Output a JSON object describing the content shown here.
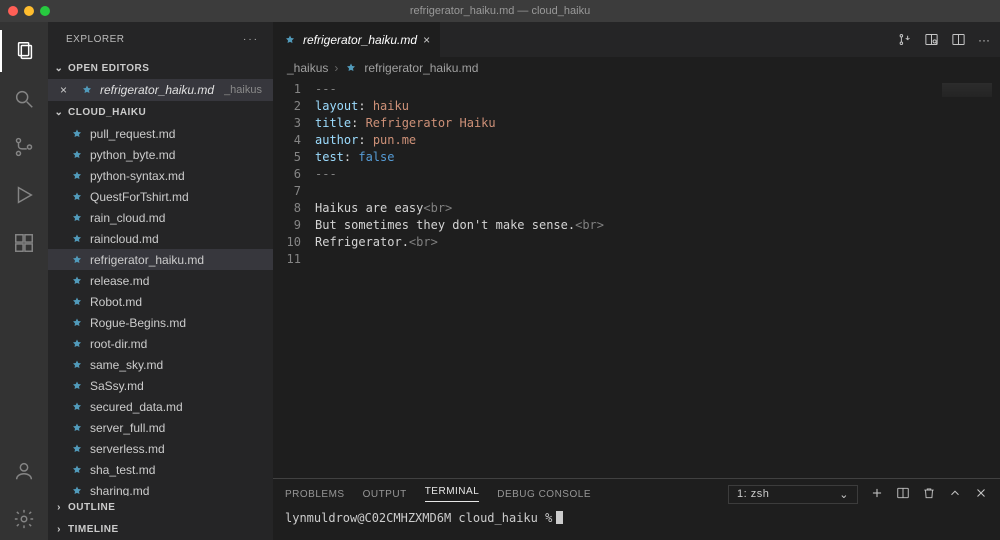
{
  "window_title": "refrigerator_haiku.md — cloud_haiku",
  "explorer": {
    "title": "EXPLORER",
    "open_editors_label": "OPEN EDITORS",
    "open_editor": {
      "name": "refrigerator_haiku.md",
      "hint": "_haikus"
    },
    "project_label": "CLOUD_HAIKU",
    "files": [
      "pull_request.md",
      "python_byte.md",
      "python-syntax.md",
      "QuestForTshirt.md",
      "rain_cloud.md",
      "raincloud.md",
      "refrigerator_haiku.md",
      "release.md",
      "Robot.md",
      "Rogue-Begins.md",
      "root-dir.md",
      "same_sky.md",
      "SaSsy.md",
      "secured_data.md",
      "server_full.md",
      "serverless.md",
      "sha_test.md",
      "sharing.md"
    ],
    "selected": "refrigerator_haiku.md",
    "outline_label": "OUTLINE",
    "timeline_label": "TIMELINE"
  },
  "tab": {
    "name": "refrigerator_haiku.md"
  },
  "breadcrumb": {
    "folder": "_haikus",
    "file": "refrigerator_haiku.md"
  },
  "code": {
    "lines": [
      "1",
      "2",
      "3",
      "4",
      "5",
      "6",
      "7",
      "8",
      "9",
      "10",
      "11"
    ],
    "l1": "---",
    "l2a": "layout",
    "l2b": ": ",
    "l2c": "haiku",
    "l3a": "title",
    "l3b": ": ",
    "l3c": "Refrigerator Haiku",
    "l4a": "author",
    "l4b": ": ",
    "l4c": "pun.me",
    "l5a": "test",
    "l5b": ": ",
    "l5c": "false",
    "l6": "---",
    "l8": "Haikus are easy",
    "l9": "But sometimes they don't make sense.",
    "l10": "Refrigerator.",
    "br": "<br>"
  },
  "panel": {
    "tabs": {
      "problems": "PROBLEMS",
      "output": "OUTPUT",
      "terminal": "TERMINAL",
      "debug": "DEBUG CONSOLE"
    },
    "term_selector": "1: zsh",
    "prompt": "lynmuldrow@C02CMHZXMD6M cloud_haiku % "
  }
}
